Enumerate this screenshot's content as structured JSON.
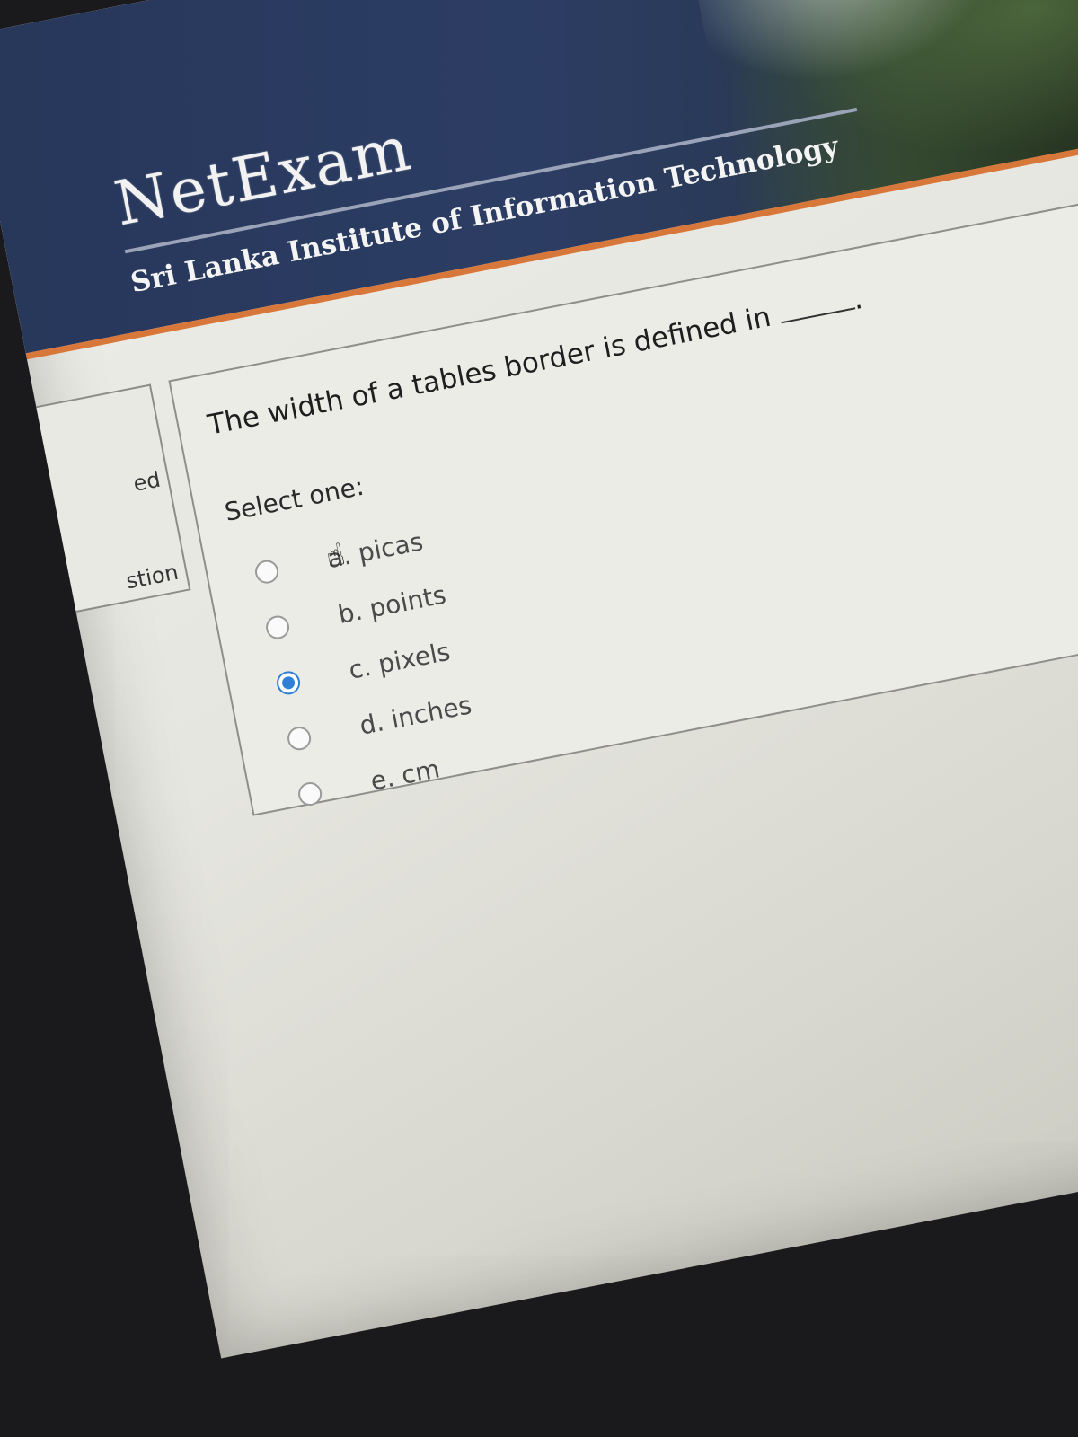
{
  "header": {
    "logo_text": "NetExam",
    "institute": "Sri Lanka Institute of Information Technology"
  },
  "nav": {
    "partial_label_top": "ed",
    "partial_label_bottom": "stion"
  },
  "question": {
    "text": "The width of a tables border is defined in",
    "trailing_punctuation": ".",
    "prompt": "Select one:",
    "options": [
      {
        "label": "a. picas",
        "selected": false
      },
      {
        "label": "b. points",
        "selected": false
      },
      {
        "label": "c. pixels",
        "selected": true
      },
      {
        "label": "d. inches",
        "selected": false
      },
      {
        "label": "e. cm",
        "selected": false
      }
    ]
  },
  "colors": {
    "banner": "#2c3d64",
    "accent": "#d8773a",
    "radio_selected": "#2f7ed8"
  },
  "icons": {
    "cursor": "hand-pointer-icon"
  }
}
